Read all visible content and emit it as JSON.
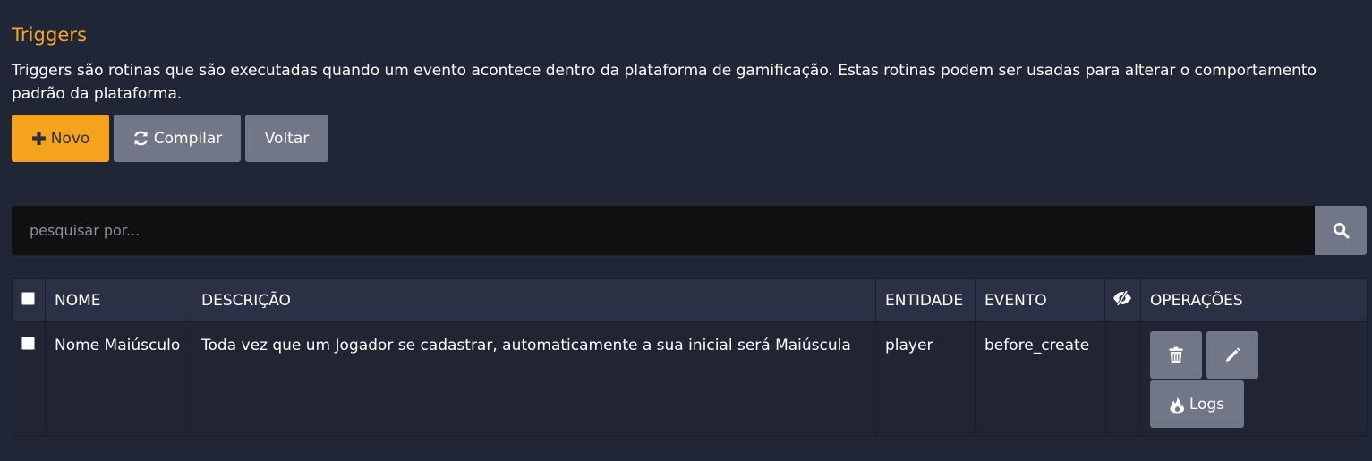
{
  "header": {
    "title": "Triggers",
    "description": "Triggers são rotinas que são executadas quando um evento acontece dentro da plataforma de gamificação. Estas rotinas podem ser usadas para alterar o comportamento padrão da plataforma."
  },
  "toolbar": {
    "new_label": "Novo",
    "compile_label": "Compilar",
    "back_label": "Voltar"
  },
  "search": {
    "placeholder": "pesquisar por...",
    "value": ""
  },
  "table": {
    "columns": {
      "name": "NOME",
      "description": "DESCRIÇÃO",
      "entity": "ENTIDADE",
      "event": "EVENTO",
      "operations": "OPERAÇÕES"
    },
    "rows": [
      {
        "name": "Nome Maiúsculo",
        "description": "Toda vez que um Jogador se cadastrar, automaticamente a sua inicial será Maiúscula",
        "entity": "player",
        "event": "before_create",
        "logs_label": "Logs"
      }
    ]
  },
  "colors": {
    "background": "#212636",
    "accent": "#f5a21c",
    "secondary_button": "#727788",
    "table_header": "#2b3045",
    "search_input": "#111111"
  },
  "icons": {
    "new": "plus-icon",
    "compile": "refresh-icon",
    "search": "search-icon",
    "visibility_column": "eye-slash-icon",
    "delete": "trash-icon",
    "edit": "pencil-icon",
    "logs": "fire-icon"
  }
}
